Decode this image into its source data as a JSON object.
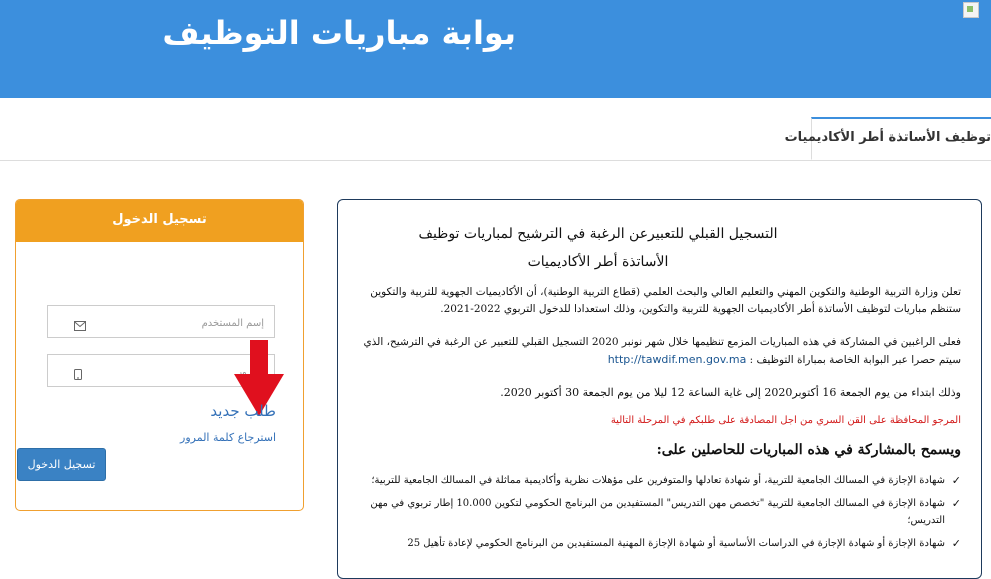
{
  "header": {
    "title": "بوابة مباريات التوظيف"
  },
  "tabs": [
    {
      "label": "توظيف الأساتذة أطر الأكاديميات"
    }
  ],
  "login": {
    "title": "تسجيل الدخول",
    "username_placeholder": "إسم المستخدم",
    "password_placeholder": "المرور",
    "new_request": "طلب جديد",
    "recover_password": "استرجاع كلمة المرور",
    "submit": "تسجيل الدخول"
  },
  "announcement": {
    "title_line1": "التسجيل القبلي للتعبيرعن الرغبة في الترشيح لمباريات توظيف",
    "title_line2": "الأساتذة أطر الأكاديميات",
    "p1": "تعلن وزارة التربية الوطنية والتكوين المهني والتعليم العالي والبحث العلمي (قطاع التربية الوطنية)، أن الأكاديميات الجهوية للتربية والتكوين ستنظم مباريات لتوظيف الأساتذة أطر الأكاديميات الجهوية للتربية والتكوين، وذلك استعدادا للدخول التربوي 2022-2021.",
    "p2": "فعلى الراغبين في المشاركة في هذه المباريات المزمع تنظيمها خلال شهر نونبر 2020 التسجيل القبلي للتعبير عن الرغبة في الترشيح، الذي سيتم حصرا عبر البوابة الخاصة بمباراة التوظيف :",
    "url": "http://tawdif.men.gov.ma",
    "p3": "وذلك ابتداء من يوم الجمعة 16 أكتوبر2020 إلى غاية الساعة 12 ليلا من يوم الجمعة 30 أكتوبر 2020.",
    "warning": "المرجو المحافظة على القن السري من اجل المصادقة على طلبكم في المرحلة التالية",
    "allowed_title": "ويسمح بالمشاركة في هذه المباريات للحاصلين على:",
    "items": [
      "شهادة الإجازة في المسالك الجامعية للتربية، أو شهادة تعادلها والمتوفرين على مؤهلات نظرية وأكاديمية مماثلة في المسالك الجامعية للتربية؛",
      "شهادة الإجازة في المسالك الجامعية للتربية \"تخصص مهن التدريس\" المستفيدين من البرنامج الحكومي لتكوين 10.000 إطار تربوي في مهن التدريس؛",
      "شهادة الإجازة أو شهادة الإجازة في الدراسات الأساسية أو شهادة الإجازة المهنية المستفيدين من البرنامج الحكومي لإعادة تأهيل 25"
    ],
    "check_icon": "✓"
  }
}
